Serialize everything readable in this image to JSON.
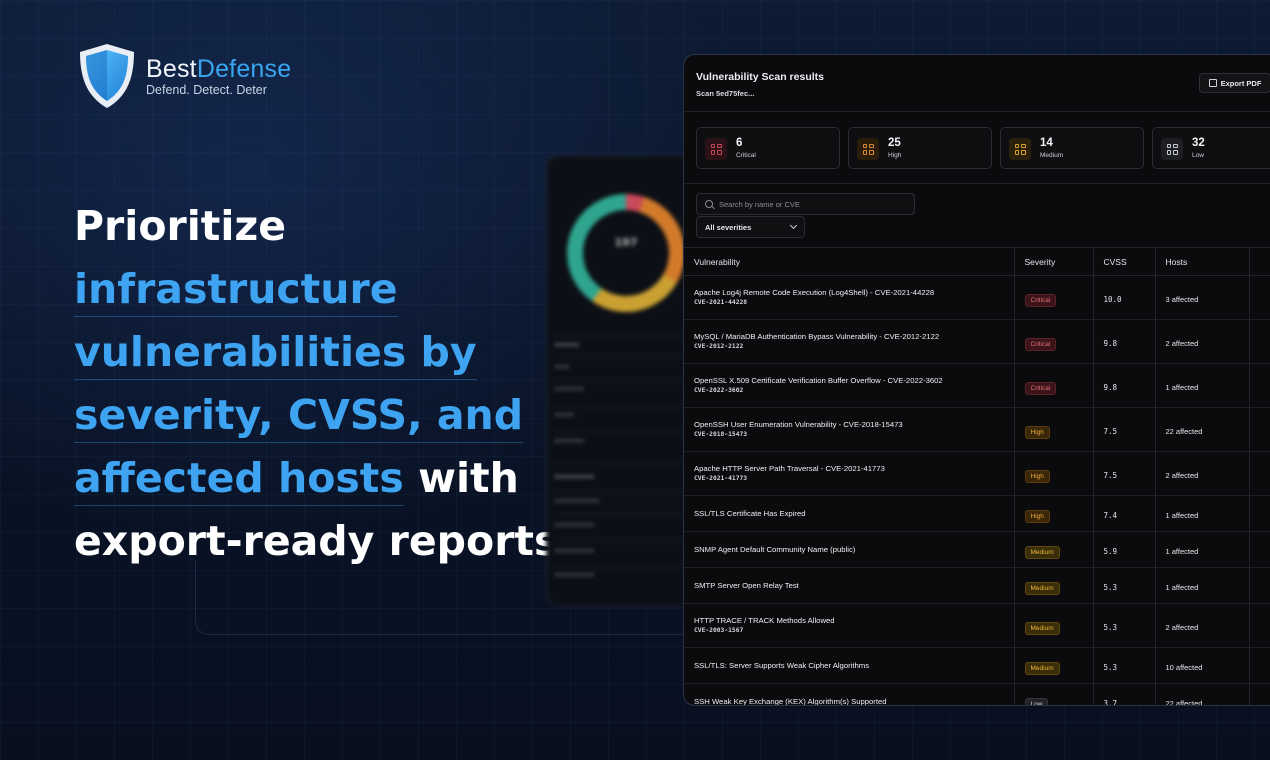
{
  "brand": {
    "name_part1": "Best",
    "name_part2": "Defense",
    "tagline": "Defend. Detect. Deter"
  },
  "headline": {
    "line1": "Prioritize",
    "line2": "infrastructure",
    "line3": "vulnerabilities by",
    "line4": "severity, CVSS, and",
    "line5_blue": "affected hosts",
    "line5_tail": " with",
    "line6": "export-ready reports."
  },
  "back_panel": {
    "total": "197"
  },
  "app": {
    "title": "Vulnerability Scan results",
    "subtitle": "Scan 5ed75fec...",
    "export_label": "Export PDF",
    "summary": [
      {
        "count": "6",
        "label": "Critical",
        "color": "#c9475a",
        "bg": "#2a1216"
      },
      {
        "count": "25",
        "label": "High",
        "color": "#d98a2c",
        "bg": "#2a1d0c"
      },
      {
        "count": "14",
        "label": "Medium",
        "color": "#d9a030",
        "bg": "#2a200c"
      },
      {
        "count": "32",
        "label": "Low",
        "color": "#c8cbd2",
        "bg": "#1e1f24"
      }
    ],
    "search_placeholder": "Search by name or CVE",
    "severity_filter": "All severities",
    "columns": [
      "Vulnerability",
      "Severity",
      "CVSS",
      "Hosts"
    ],
    "rows": [
      {
        "name": "Apache Log4j Remote Code Execution (Log4Shell) - CVE-2021-44228",
        "cve": "CVE-2021-44228",
        "severity": "Critical",
        "cvss": "10.0",
        "hosts": "3 affected"
      },
      {
        "name": "MySQL / MariaDB Authentication Bypass Vulnerability - CVE-2012-2122",
        "cve": "CVE-2012-2122",
        "severity": "Critical",
        "cvss": "9.8",
        "hosts": "2 affected"
      },
      {
        "name": "OpenSSL X.509 Certificate Verification Buffer Overflow - CVE-2022-3602",
        "cve": "CVE-2022-3602",
        "severity": "Critical",
        "cvss": "9.8",
        "hosts": "1 affected"
      },
      {
        "name": "OpenSSH User Enumeration Vulnerability - CVE-2018-15473",
        "cve": "CVE-2018-15473",
        "severity": "High",
        "cvss": "7.5",
        "hosts": "22 affected"
      },
      {
        "name": "Apache HTTP Server Path Traversal - CVE-2021-41773",
        "cve": "CVE-2021-41773",
        "severity": "High",
        "cvss": "7.5",
        "hosts": "2 affected"
      },
      {
        "name": "SSL/TLS Certificate Has Expired",
        "cve": "",
        "severity": "High",
        "cvss": "7.4",
        "hosts": "1 affected"
      },
      {
        "name": "SNMP Agent Default Community Name (public)",
        "cve": "",
        "severity": "Medium",
        "cvss": "5.9",
        "hosts": "1 affected"
      },
      {
        "name": "SMTP Server Open Relay Test",
        "cve": "",
        "severity": "Medium",
        "cvss": "5.3",
        "hosts": "1 affected"
      },
      {
        "name": "HTTP TRACE / TRACK Methods Allowed",
        "cve": "CVE-2003-1567",
        "severity": "Medium",
        "cvss": "5.3",
        "hosts": "2 affected"
      },
      {
        "name": "SSL/TLS: Server Supports Weak Cipher Algorithms",
        "cve": "",
        "severity": "Medium",
        "cvss": "5.3",
        "hosts": "10 affected"
      },
      {
        "name": "SSH Weak Key Exchange (KEX) Algorithm(s) Supported",
        "cve": "",
        "severity": "Low",
        "cvss": "3.7",
        "hosts": "22 affected"
      }
    ]
  }
}
